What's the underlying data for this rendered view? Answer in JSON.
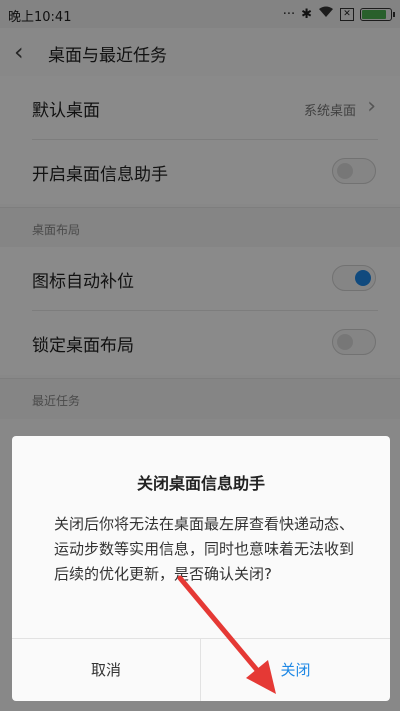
{
  "status_bar": {
    "time": "晚上10:41",
    "battery_level": 0.85,
    "battery_color": "#4caf50"
  },
  "header": {
    "title": "桌面与最近任务"
  },
  "rows": [
    {
      "label": "默认桌面",
      "value": "系统桌面"
    },
    {
      "label": "开启桌面信息助手",
      "toggle": false
    }
  ],
  "sections": [
    {
      "label": "桌面布局",
      "rows": [
        {
          "label": "图标自动补位",
          "toggle": true
        },
        {
          "label": "锁定桌面布局",
          "toggle": false
        }
      ]
    },
    {
      "label": "最近任务"
    }
  ],
  "dialog": {
    "title": "关闭桌面信息助手",
    "message": "关闭后你将无法在桌面最左屏查看快递动态、运动步数等实用信息，同时也意味着无法收到后续的优化更新，是否确认关闭?",
    "cancel_label": "取消",
    "confirm_label": "关闭"
  },
  "colors": {
    "accent": "#1e88e5",
    "arrow": "#e53935"
  }
}
